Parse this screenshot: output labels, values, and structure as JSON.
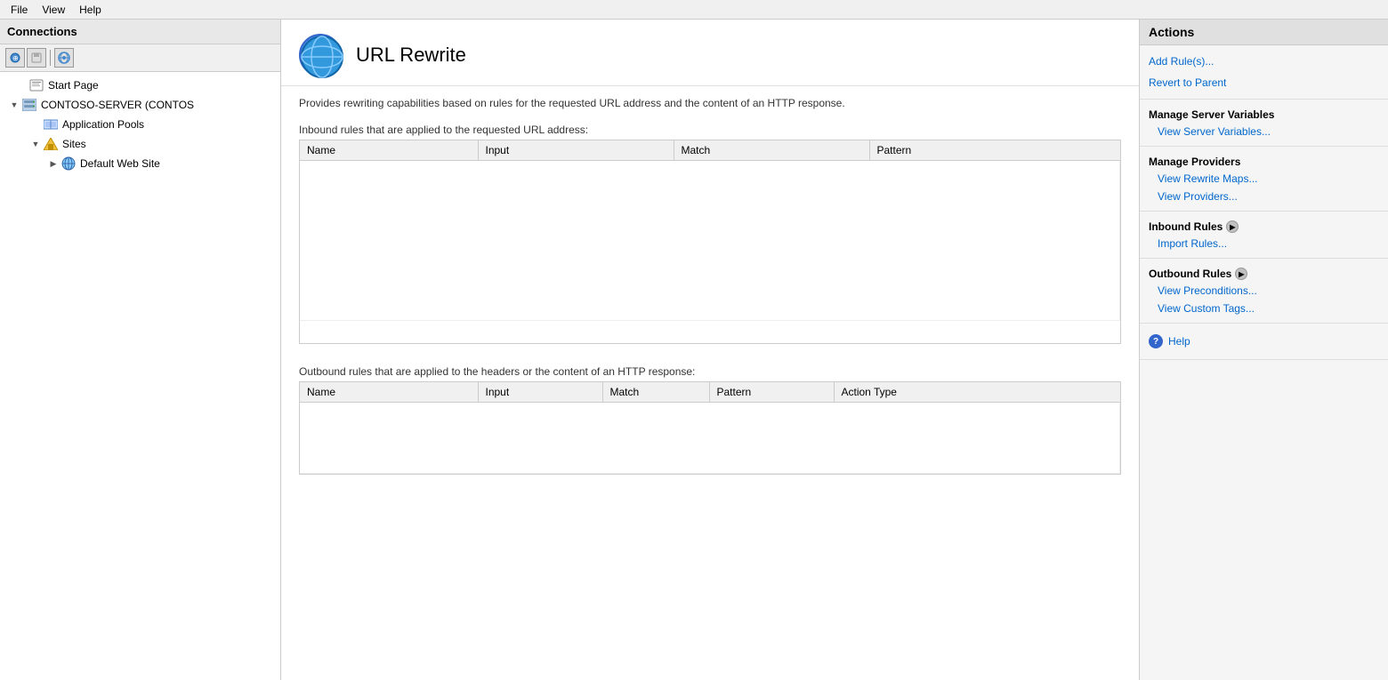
{
  "menubar": {
    "items": [
      "File",
      "View",
      "Help"
    ]
  },
  "sidebar": {
    "title": "Connections",
    "tree": [
      {
        "id": "start-page",
        "label": "Start Page",
        "level": 1,
        "icon": "page",
        "indent": 16
      },
      {
        "id": "server",
        "label": "CONTOSO-SERVER (CONTOS",
        "level": 1,
        "icon": "server",
        "indent": 16,
        "expanded": true
      },
      {
        "id": "apppools",
        "label": "Application Pools",
        "level": 2,
        "icon": "apppool",
        "indent": 32
      },
      {
        "id": "sites",
        "label": "Sites",
        "level": 2,
        "icon": "folder",
        "indent": 32,
        "expanded": true
      },
      {
        "id": "default-site",
        "label": "Default Web Site",
        "level": 3,
        "icon": "site",
        "indent": 52
      }
    ]
  },
  "content": {
    "title": "URL Rewrite",
    "description": "Provides rewriting capabilities based on rules for the requested URL address and the content of an HTTP response.",
    "inbound_label": "Inbound rules that are applied to the requested URL address:",
    "outbound_label": "Outbound rules that are applied to the headers or the content of an HTTP response:",
    "inbound_columns": [
      "Name",
      "Input",
      "Match",
      "Pattern"
    ],
    "outbound_columns": [
      "Name",
      "Input",
      "Match",
      "Pattern",
      "Action Type"
    ]
  },
  "actions": {
    "title": "Actions",
    "links_top": [
      {
        "id": "add-rules",
        "label": "Add Rule(s)..."
      },
      {
        "id": "revert",
        "label": "Revert to Parent"
      }
    ],
    "manage_server_variables": {
      "title": "Manage Server Variables",
      "links": [
        {
          "id": "view-server-vars",
          "label": "View Server Variables..."
        }
      ]
    },
    "manage_providers": {
      "title": "Manage Providers",
      "links": [
        {
          "id": "view-rewrite-maps",
          "label": "View Rewrite Maps..."
        },
        {
          "id": "view-providers",
          "label": "View Providers..."
        }
      ]
    },
    "inbound_rules": {
      "title": "Inbound Rules",
      "links": [
        {
          "id": "import-rules",
          "label": "Import Rules..."
        }
      ]
    },
    "outbound_rules": {
      "title": "Outbound Rules",
      "links": [
        {
          "id": "view-preconditions",
          "label": "View Preconditions..."
        },
        {
          "id": "view-custom-tags",
          "label": "View Custom Tags..."
        }
      ]
    },
    "help": {
      "label": "Help"
    }
  }
}
